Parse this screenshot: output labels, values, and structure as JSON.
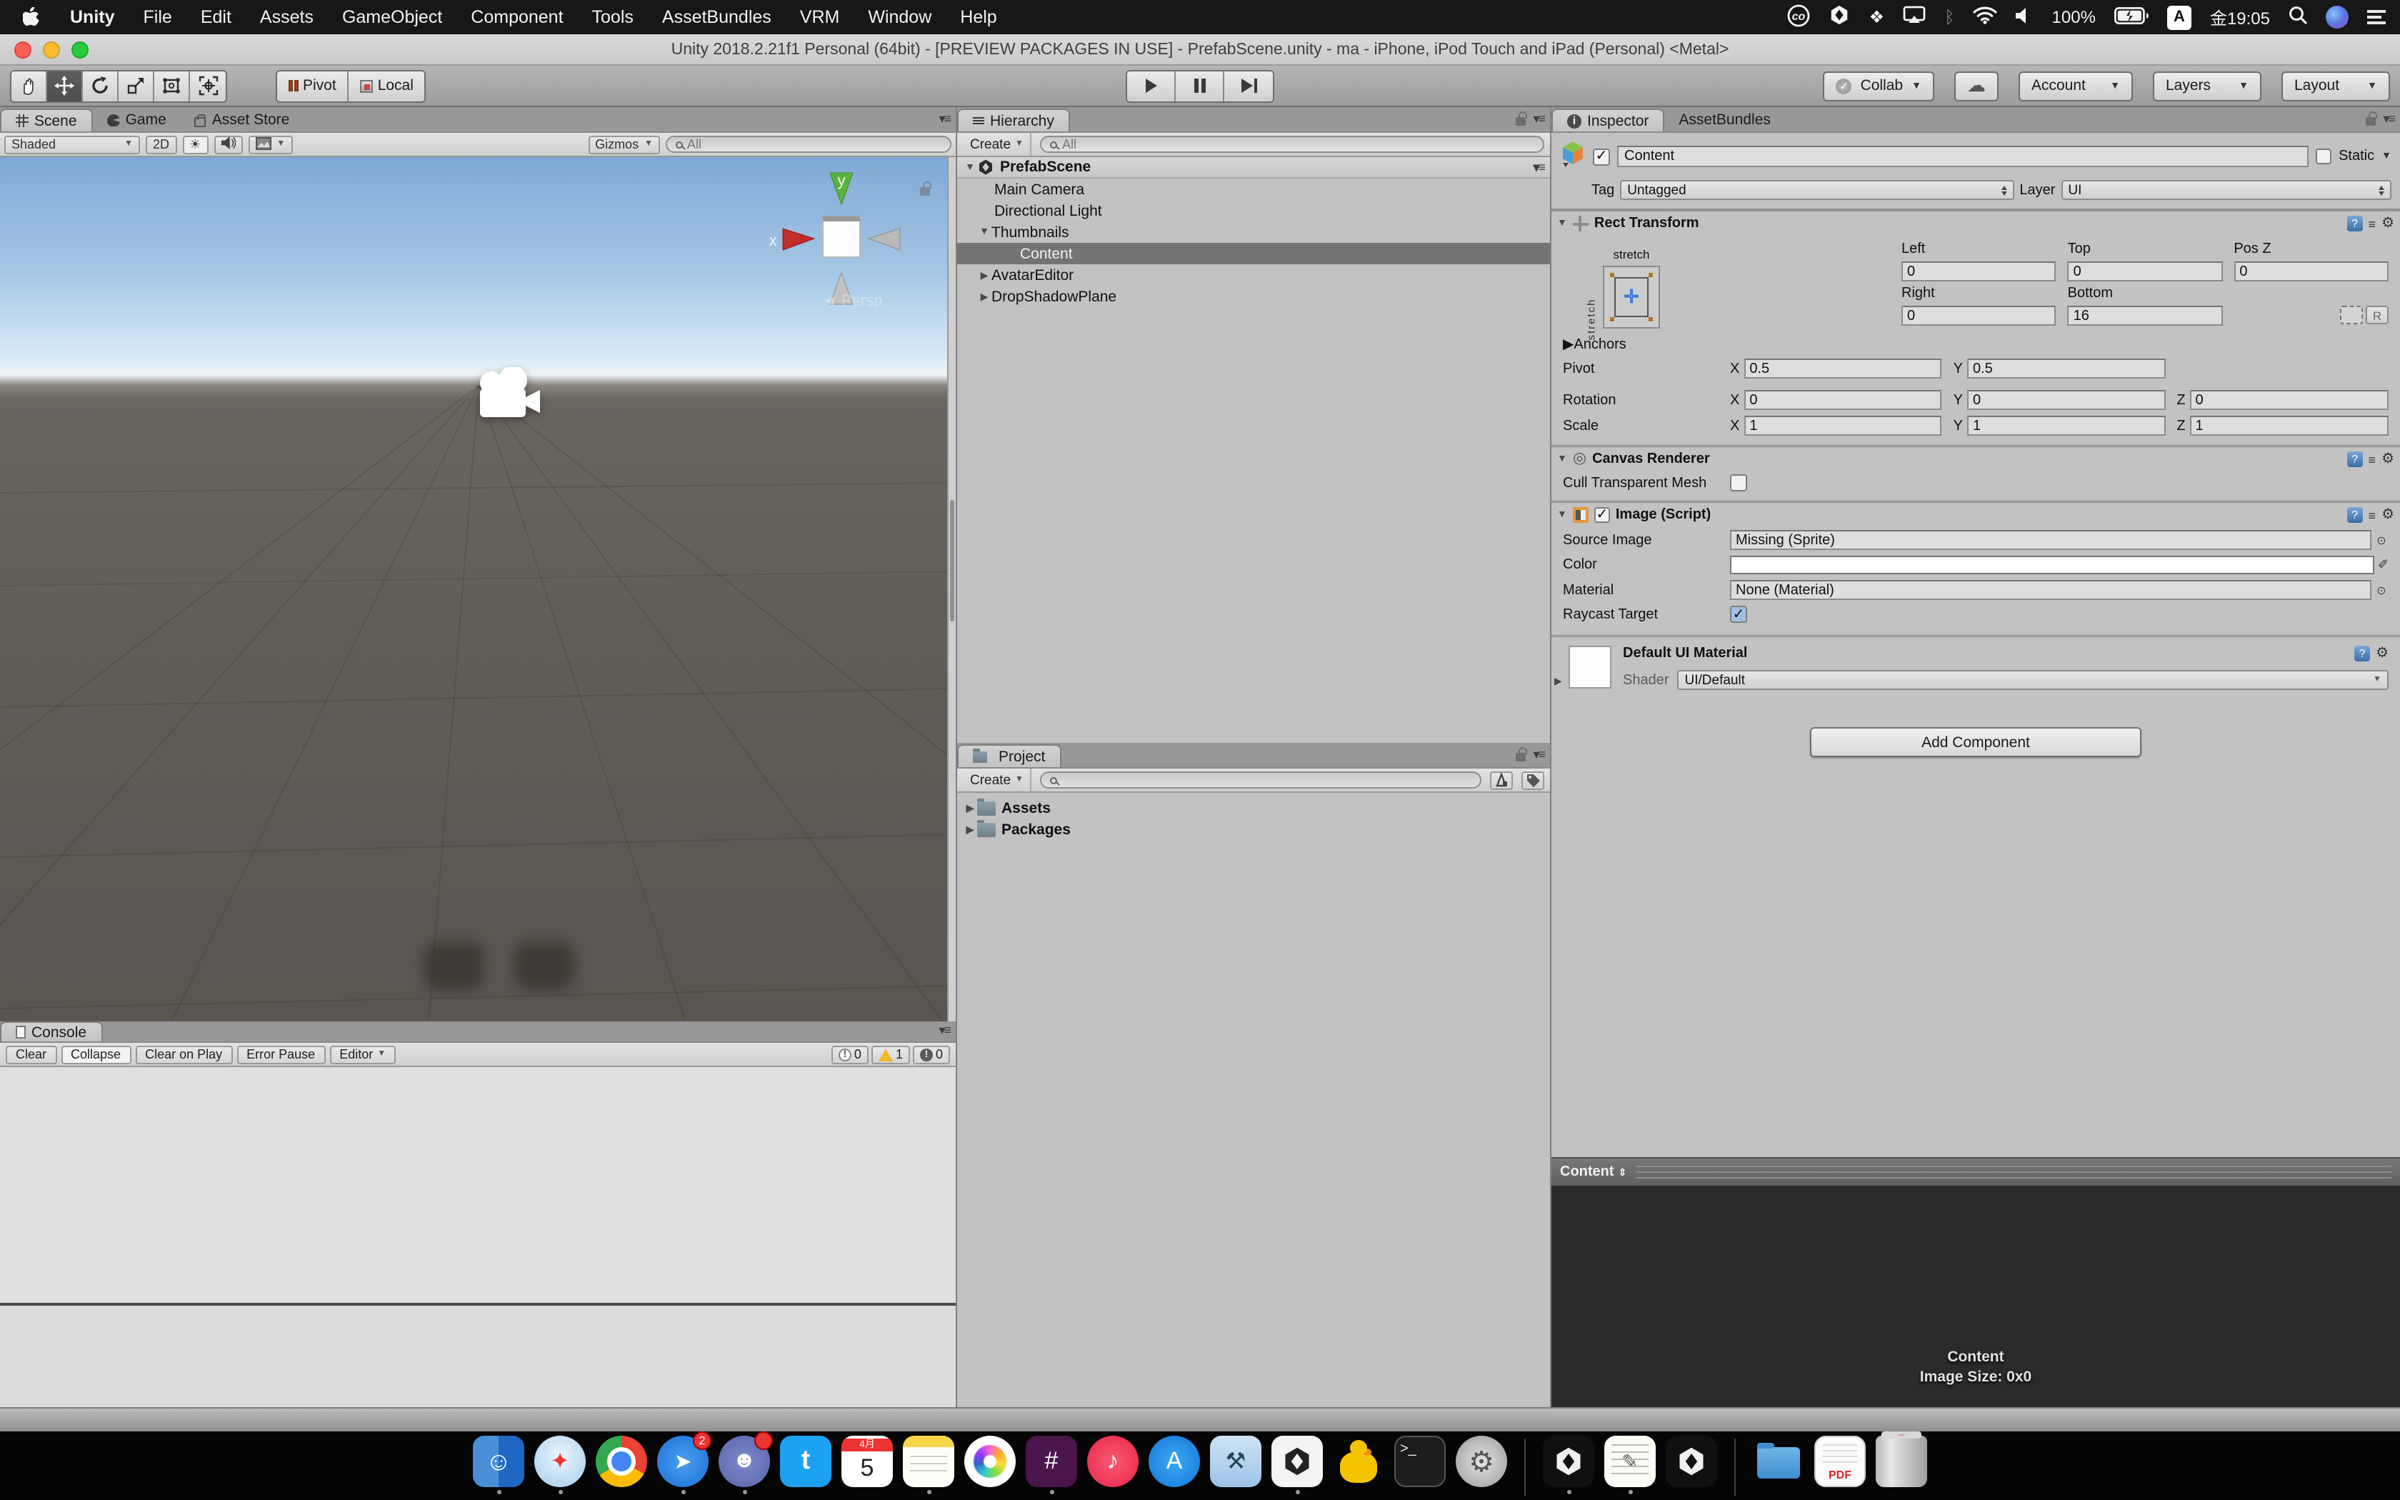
{
  "colors": {
    "selection": "#747474",
    "warning_yellow": "#f1b82d",
    "preview_bg": "#2a2a2a",
    "anchor_blue": "#3e7de0",
    "sky_blue": "#7fa8d4",
    "ground_brown": "#615c56"
  },
  "menu_bar": {
    "items": [
      "Unity",
      "File",
      "Edit",
      "Assets",
      "GameObject",
      "Component",
      "Tools",
      "AssetBundles",
      "VRM",
      "Window",
      "Help"
    ],
    "battery_pct": "100%",
    "input_source": "A",
    "clock": "金19:05"
  },
  "title_bar": {
    "title": "Unity 2018.2.21f1 Personal (64bit) - [PREVIEW PACKAGES IN USE] - PrefabScene.unity - ma - iPhone, iPod Touch and iPad (Personal) <Metal>"
  },
  "toolbar": {
    "pivot": "Pivot",
    "local": "Local",
    "collab": "Collab",
    "account": "Account",
    "layers": "Layers",
    "layout": "Layout"
  },
  "scene": {
    "tabs": [
      "Scene",
      "Game",
      "Asset Store"
    ],
    "draw_mode": "Shaded",
    "btn_2d": "2D",
    "gizmos": "Gizmos",
    "search": "All",
    "axis_y": "y",
    "axis_x": "x",
    "persp": "Persp"
  },
  "hierarchy": {
    "tab": "Hierarchy",
    "create": "Create",
    "search": "All",
    "root": "PrefabScene",
    "items": [
      {
        "label": "Main Camera"
      },
      {
        "label": "Directional Light"
      },
      {
        "label": "Thumbnails"
      },
      {
        "label": "Content"
      },
      {
        "label": "AvatarEditor"
      },
      {
        "label": "DropShadowPlane"
      }
    ]
  },
  "project": {
    "tab": "Project",
    "create": "Create",
    "folders": [
      {
        "label": "Assets"
      },
      {
        "label": "Packages"
      }
    ]
  },
  "console": {
    "tab": "Console",
    "clear": "Clear",
    "collapse": "Collapse",
    "clear_on_play": "Clear on Play",
    "error_pause": "Error Pause",
    "editor": "Editor",
    "info_count": "0",
    "warning_count": "1",
    "error_count": "0"
  },
  "inspector": {
    "tabs": [
      "Inspector",
      "AssetBundles"
    ],
    "header": {
      "name": "Content",
      "static": "Static",
      "tag_label": "Tag",
      "tag": "Untagged",
      "layer_label": "Layer",
      "layer": "UI"
    },
    "axis": {
      "x": "X",
      "y": "Y",
      "z": "Z"
    },
    "rect_transform": {
      "title": "Rect Transform",
      "stretch": "stretch",
      "left_label": "Left",
      "top_label": "Top",
      "posz_label": "Pos Z",
      "left": "0",
      "top": "0",
      "pos_z": "0",
      "right_label": "Right",
      "bottom_label": "Bottom",
      "right": "0",
      "bottom": "16",
      "r_button": "R",
      "anchors": "Anchors",
      "pivot_label": "Pivot",
      "pivot_x": "0.5",
      "pivot_y": "0.5",
      "rotation_label": "Rotation",
      "rotation_x": "0",
      "rotation_y": "0",
      "rotation_z": "0",
      "scale_label": "Scale",
      "scale_x": "1",
      "scale_y": "1",
      "scale_z": "1"
    },
    "canvas_renderer": {
      "title": "Canvas Renderer",
      "cull_label": "Cull Transparent Mesh"
    },
    "image": {
      "title": "Image (Script)",
      "source_label": "Source Image",
      "source": "Missing (Sprite)",
      "color_label": "Color",
      "material_label": "Material",
      "material": "None (Material)",
      "raycast_label": "Raycast Target"
    },
    "material_block": {
      "title": "Default UI Material",
      "shader_label": "Shader",
      "shader": "UI/Default"
    },
    "add_component": "Add Component",
    "preview": {
      "tab": "Content",
      "name": "Content",
      "size": "Image Size: 0x0"
    }
  },
  "dock": {
    "calendar": {
      "month": "4月",
      "day": "5"
    },
    "badges": {
      "spark": "2"
    },
    "glyphs": {
      "finder": "☺",
      "safari": "✦",
      "spark": "➤",
      "discord": "☻",
      "twitter": "t",
      "music": "♪",
      "slack": "#",
      "appstore": "A",
      "xcode": "⚒",
      "terminal": ">_",
      "prefs": "⚙",
      "textedit": "✎",
      "pdf": "PDF"
    }
  }
}
